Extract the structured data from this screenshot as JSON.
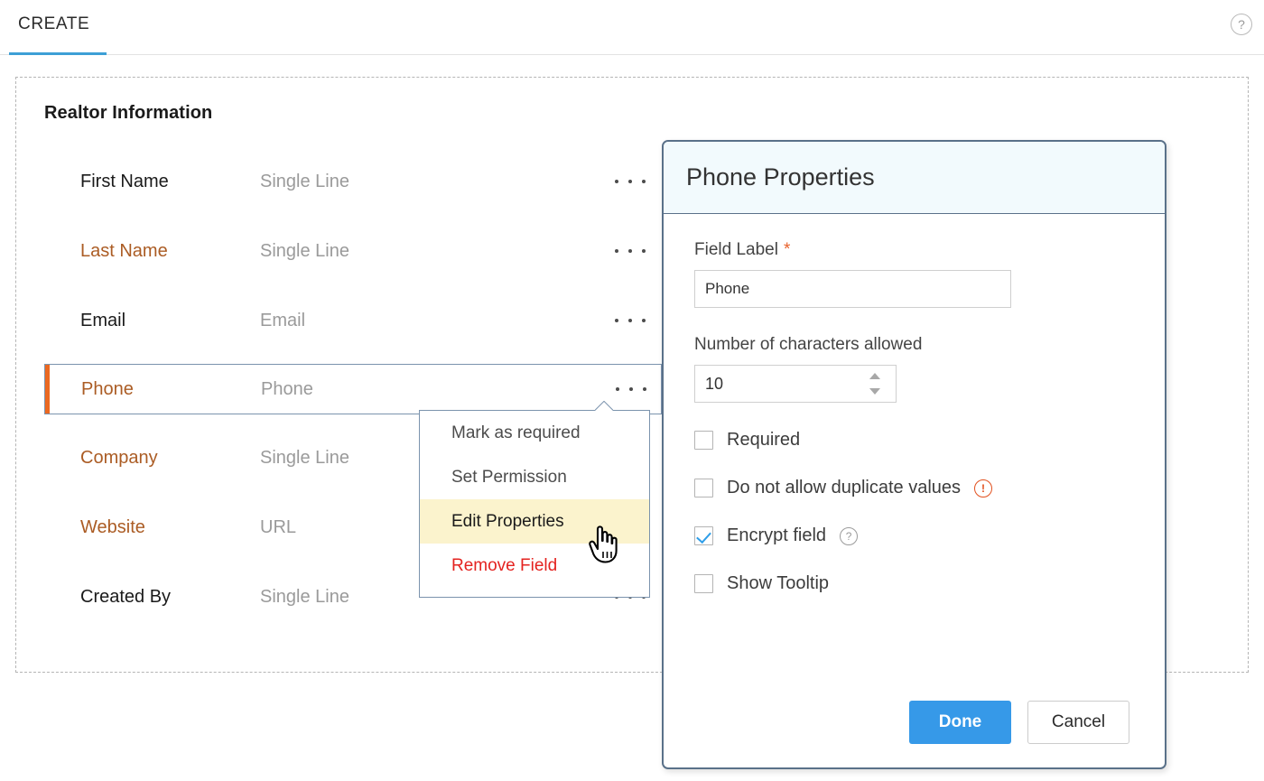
{
  "topbar": {
    "tab_label": "CREATE",
    "help_icon": "help-circle-icon",
    "help_glyph": "?",
    "accent_color": "#3d9fd6"
  },
  "form": {
    "section_title": "Realtor Information",
    "ellipsis_icon": "more-options-icon",
    "fields": [
      {
        "label": "First Name",
        "placeholder": "Single Line",
        "accent": false
      },
      {
        "label": "Last Name",
        "placeholder": "Single Line",
        "accent": true
      },
      {
        "label": "Email",
        "placeholder": "Email",
        "accent": false
      },
      {
        "label": "Phone",
        "placeholder": "Phone",
        "accent": true
      },
      {
        "label": "Company",
        "placeholder": "Single Line",
        "accent": true
      },
      {
        "label": "Website",
        "placeholder": "URL",
        "accent": true
      },
      {
        "label": "Created By",
        "placeholder": "Single Line",
        "accent": false
      }
    ],
    "selected_field": "Phone",
    "selected_accent_color": "#eb6820"
  },
  "context_menu": {
    "items": [
      {
        "label": "Mark as required",
        "state": "normal"
      },
      {
        "label": "Set Permission",
        "state": "normal"
      },
      {
        "label": "Edit Properties",
        "state": "highlight"
      },
      {
        "label": "Remove Field",
        "state": "danger"
      }
    ],
    "highlight_color": "#fbf3cd",
    "danger_color": "#e42320",
    "cursor_icon": "hand-pointer-cursor"
  },
  "dialog": {
    "title": "Phone Properties",
    "field_label": {
      "label": "Field Label",
      "required_marker": "*",
      "value": "Phone",
      "placeholder": "Phone"
    },
    "num_chars": {
      "label": "Number of characters allowed",
      "value": "10",
      "spinner_up_icon": "spinner-up-icon",
      "spinner_down_icon": "spinner-down-icon"
    },
    "checkboxes": [
      {
        "label": "Required",
        "checked": false,
        "icon": null,
        "icon_glyph": null
      },
      {
        "label": "Do not allow duplicate values",
        "checked": false,
        "icon": "warning-circle-icon",
        "icon_glyph": "!"
      },
      {
        "label": "Encrypt field",
        "checked": true,
        "icon": "help-circle-icon",
        "icon_glyph": "?"
      },
      {
        "label": "Show Tooltip",
        "checked": false,
        "icon": null,
        "icon_glyph": null
      }
    ],
    "buttons": {
      "done": "Done",
      "cancel": "Cancel"
    },
    "done_color": "#3699e8",
    "header_bg": "#f2fafd"
  }
}
